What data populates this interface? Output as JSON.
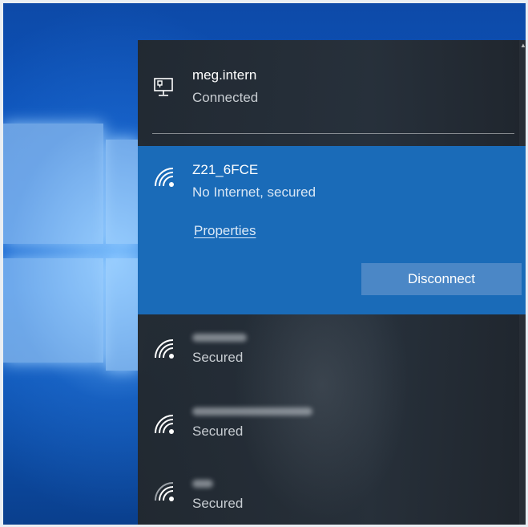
{
  "connections": [
    {
      "name": "meg.intern",
      "status": "Connected",
      "icon": "ethernet-monitor-icon"
    },
    {
      "name": "Z21_6FCE",
      "status": "No Internet, secured",
      "icon": "wifi-secured-icon",
      "selected": true,
      "properties_label": "Properties",
      "disconnect_label": "Disconnect"
    },
    {
      "name": "Stefan_Test",
      "status": "Secured",
      "icon": "wifi-secured-icon",
      "name_blurred": true
    },
    {
      "name": "TP-LINK_89F6C3",
      "status": "Secured",
      "icon": "wifi-secured-icon",
      "name_blurred": true
    },
    {
      "name": "ABC",
      "status": "Secured",
      "icon": "wifi-secured-icon",
      "name_blurred": true
    }
  ],
  "colors": {
    "panel_bg": "#283038",
    "selected_bg": "#1a6bb8",
    "disconnect_bg": "#4b87c6",
    "text_primary": "#ffffff",
    "text_secondary": "#c8cdd2"
  }
}
